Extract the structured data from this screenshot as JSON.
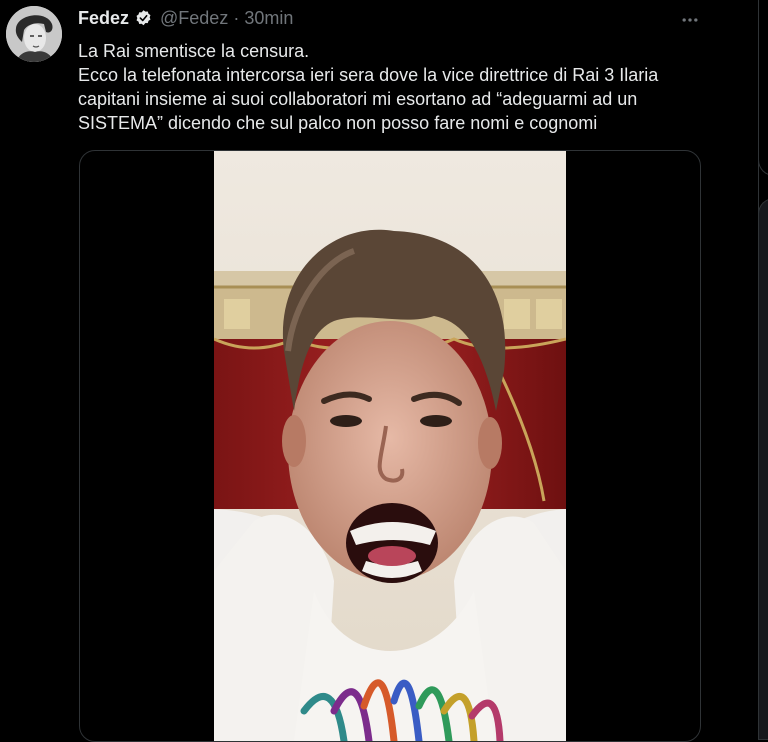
{
  "tweet": {
    "author_name": "Fedez",
    "handle": "@Fedez",
    "separator": "·",
    "time": "30min",
    "text_line1": "La Rai smentisce la censura.",
    "text_line2": "Ecco la telefonata intercorsa ieri sera dove la vice direttrice di Rai 3 Ilaria capitani insieme ai suoi collaboratori mi esortano ad “adeguarmi ad un SISTEMA” dicendo che sul palco non posso fare nomi e cognomi"
  },
  "icons": {
    "verified": "verified-badge-icon",
    "more": "more-options-icon",
    "avatar": "avatar"
  },
  "colors": {
    "background": "#000000",
    "text": "#e7e9ea",
    "secondary_text": "#71767b",
    "border": "#2f3336"
  }
}
